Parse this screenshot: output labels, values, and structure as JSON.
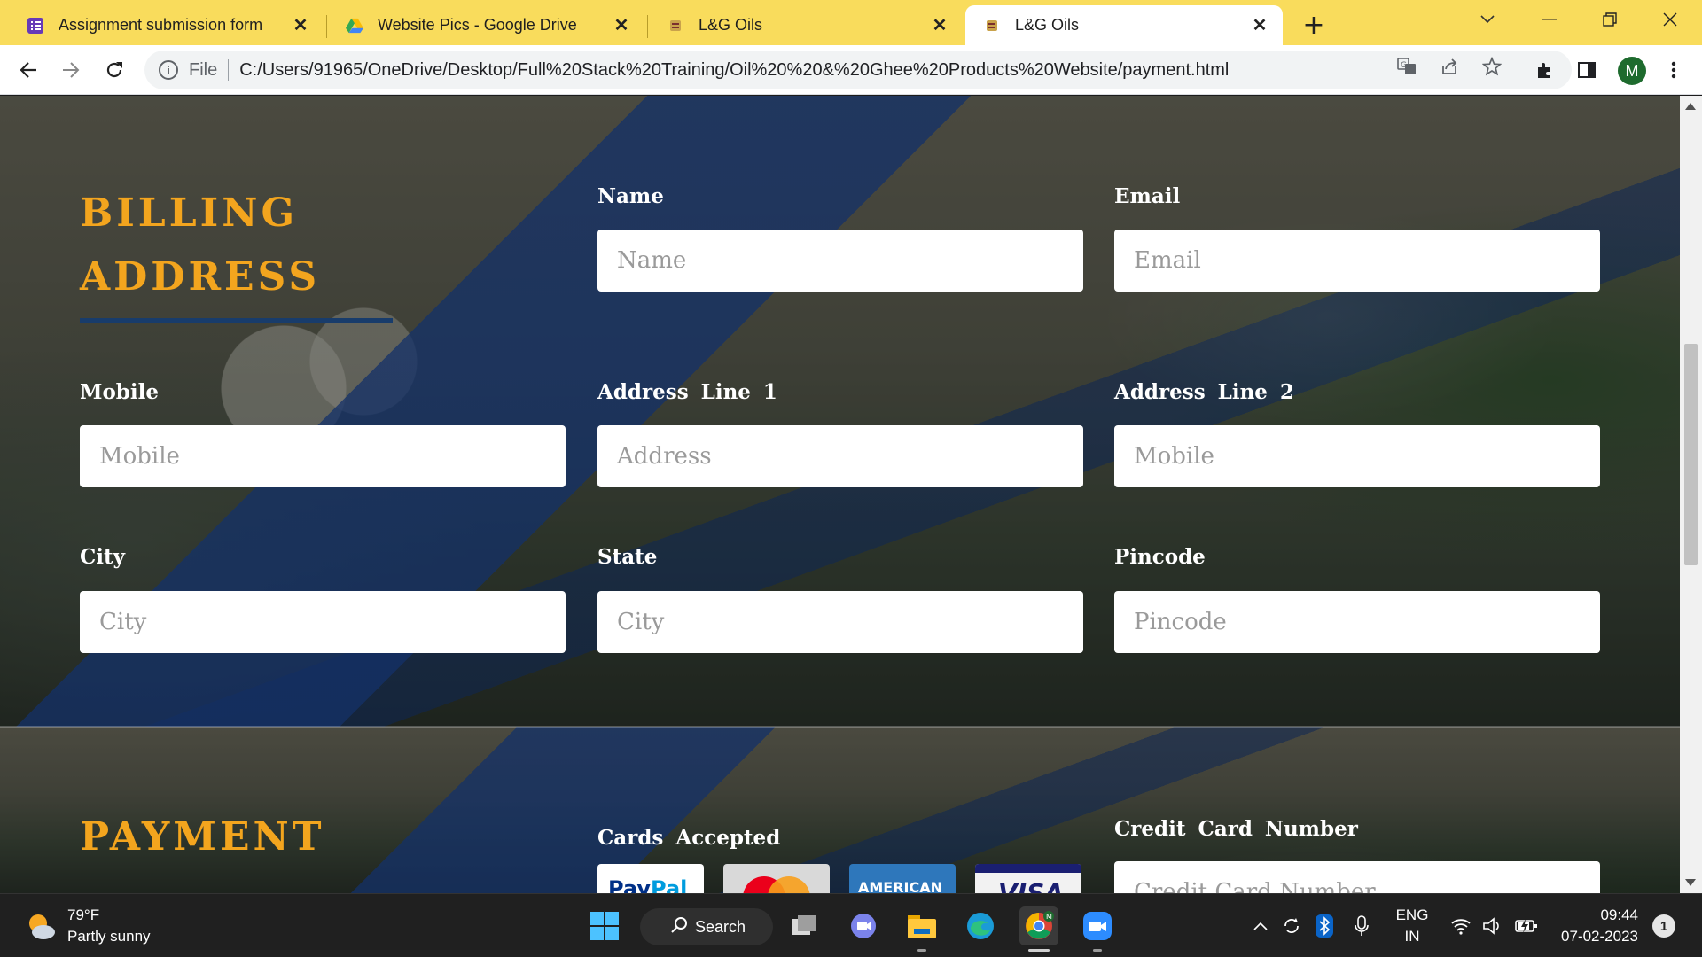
{
  "browser": {
    "tabs": [
      {
        "title": "Assignment submission form",
        "icon": "forms-icon"
      },
      {
        "title": "Website Pics - Google Drive",
        "icon": "drive-icon"
      },
      {
        "title": "L&G Oils",
        "icon": "site-favicon"
      },
      {
        "title": "L&G Oils",
        "icon": "site-favicon",
        "active": true
      }
    ],
    "address": {
      "scheme": "File",
      "url": "C:/Users/91965/OneDrive/Desktop/Full%20Stack%20Training/Oil%20%20&%20Ghee%20Products%20Website/payment.html"
    },
    "profile_initial": "M"
  },
  "billing": {
    "title_line1": "BILLING",
    "title_line2": "ADDRESS",
    "fields": [
      {
        "label": "Name",
        "placeholder": "Name"
      },
      {
        "label": "Email",
        "placeholder": "Email"
      },
      {
        "label": "Mobile",
        "placeholder": "Mobile"
      },
      {
        "label": "Address Line 1",
        "placeholder": "Address"
      },
      {
        "label": "Address Line 2",
        "placeholder": "Mobile"
      },
      {
        "label": "City",
        "placeholder": "City"
      },
      {
        "label": "State",
        "placeholder": "City"
      },
      {
        "label": "Pincode",
        "placeholder": "Pincode"
      }
    ]
  },
  "payment": {
    "title": "PAYMENT",
    "cards_label": "Cards Accepted",
    "cards": [
      "PayPal",
      "Mastercard",
      "American Express",
      "Visa"
    ],
    "card_number_label": "Credit Card Number",
    "card_number_placeholder": "Credit Card Number"
  },
  "taskbar": {
    "weather_temp": "79°F",
    "weather_desc": "Partly sunny",
    "search_label": "Search",
    "lang_line1": "ENG",
    "lang_line2": "IN",
    "time": "09:44",
    "date": "07-02-2023",
    "notification_count": "1"
  },
  "colors": {
    "tab_strip": "#f9dc5c",
    "section_title": "#f3a51e",
    "underline": "#183c6b"
  }
}
